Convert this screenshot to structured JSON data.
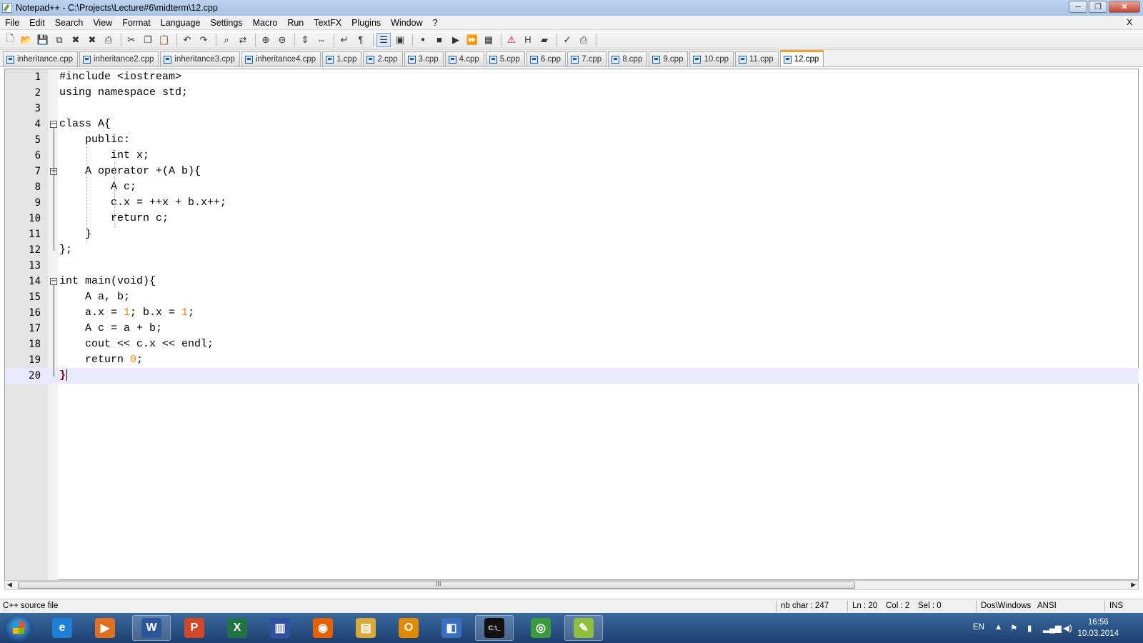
{
  "window": {
    "title": "Notepad++ - C:\\Projects\\Lecture#6\\midterm\\12.cpp",
    "min": "─",
    "max": "❐",
    "close": "✕"
  },
  "menu": [
    "File",
    "Edit",
    "Search",
    "View",
    "Format",
    "Language",
    "Settings",
    "Macro",
    "Run",
    "TextFX",
    "Plugins",
    "Window",
    "?"
  ],
  "menu_close": "X",
  "toolbar_icons": [
    "new-file-icon",
    "open-file-icon",
    "save-icon",
    "save-all-icon",
    "close-icon",
    "close-all-icon",
    "print-icon",
    "cut-icon",
    "copy-icon",
    "paste-icon",
    "undo-icon",
    "redo-icon",
    "find-icon",
    "replace-icon",
    "zoom-in-icon",
    "zoom-out-icon",
    "sync-v-icon",
    "sync-h-icon",
    "word-wrap-icon",
    "show-all-chars-icon",
    "indent-guide-icon",
    "user-lang-icon",
    "record-macro-icon",
    "stop-macro-icon",
    "play-macro-icon",
    "run-macro-multiple-icon",
    "save-macro-icon",
    "pdf-icon",
    "html-icon",
    "folder-icon",
    "spellcheck-icon",
    "print-preview-icon"
  ],
  "tabs": [
    {
      "label": "inheritance.cpp",
      "active": false
    },
    {
      "label": "inheritance2.cpp",
      "active": false
    },
    {
      "label": "inheritance3.cpp",
      "active": false
    },
    {
      "label": "inheritance4.cpp",
      "active": false
    },
    {
      "label": "1.cpp",
      "active": false
    },
    {
      "label": "2.cpp",
      "active": false
    },
    {
      "label": "3.cpp",
      "active": false
    },
    {
      "label": "4.cpp",
      "active": false
    },
    {
      "label": "5.cpp",
      "active": false
    },
    {
      "label": "6.cpp",
      "active": false
    },
    {
      "label": "7.cpp",
      "active": false
    },
    {
      "label": "8.cpp",
      "active": false
    },
    {
      "label": "9.cpp",
      "active": false
    },
    {
      "label": "10.cpp",
      "active": false
    },
    {
      "label": "11.cpp",
      "active": false
    },
    {
      "label": "12.cpp",
      "active": true
    }
  ],
  "code_lines": [
    "#include <iostream>",
    "using namespace std;",
    "",
    "class A{",
    "    public:",
    "        int x;",
    "    A operator +(A b){",
    "        A c;",
    "        c.x = ++x + b.x++;",
    "        return c;",
    "    }",
    "};",
    "",
    "int main(void){",
    "    A a, b;",
    "    a.x = 1; b.x = 1;",
    "    A c = a + b;",
    "    cout << c.x << endl;",
    "    return 0;",
    "}"
  ],
  "current_line": 20,
  "fold_marker": "−",
  "scroll_grip": "III",
  "status": {
    "lang": "C++ source file",
    "nbchar": "nb char : 247",
    "ln": "Ln : 20",
    "col": "Col : 2",
    "sel": "Sel : 0",
    "eol": "Dos\\Windows",
    "enc": "ANSI",
    "mode": "INS"
  },
  "taskbar": {
    "apps": [
      {
        "name": "ie",
        "label": "e",
        "color": "#1e7fd6",
        "open": false
      },
      {
        "name": "media-player",
        "label": "▶",
        "color": "#e07020",
        "open": false
      },
      {
        "name": "word",
        "label": "W",
        "color": "#2b579a",
        "open": true
      },
      {
        "name": "powerpoint",
        "label": "P",
        "color": "#d24726",
        "open": false
      },
      {
        "name": "excel",
        "label": "X",
        "color": "#217346",
        "open": false
      },
      {
        "name": "library",
        "label": "▥",
        "color": "#3050a0",
        "open": false
      },
      {
        "name": "firefox",
        "label": "◉",
        "color": "#e66000",
        "open": false
      },
      {
        "name": "explorer",
        "label": "▤",
        "color": "#d9a93a",
        "open": false
      },
      {
        "name": "outlook",
        "label": "O",
        "color": "#e08a00",
        "open": false
      },
      {
        "name": "remote",
        "label": "◧",
        "color": "#3a6fc0",
        "open": false
      },
      {
        "name": "cmd",
        "label": "C:\\_",
        "color": "#111111",
        "open": true
      },
      {
        "name": "chrome",
        "label": "◎",
        "color": "#3b9a3b",
        "open": false
      },
      {
        "name": "notepadpp",
        "label": "✎",
        "color": "#8fbf3f",
        "open": true
      }
    ],
    "lang": "EN",
    "time": "16:56",
    "date": "10.03.2014"
  }
}
